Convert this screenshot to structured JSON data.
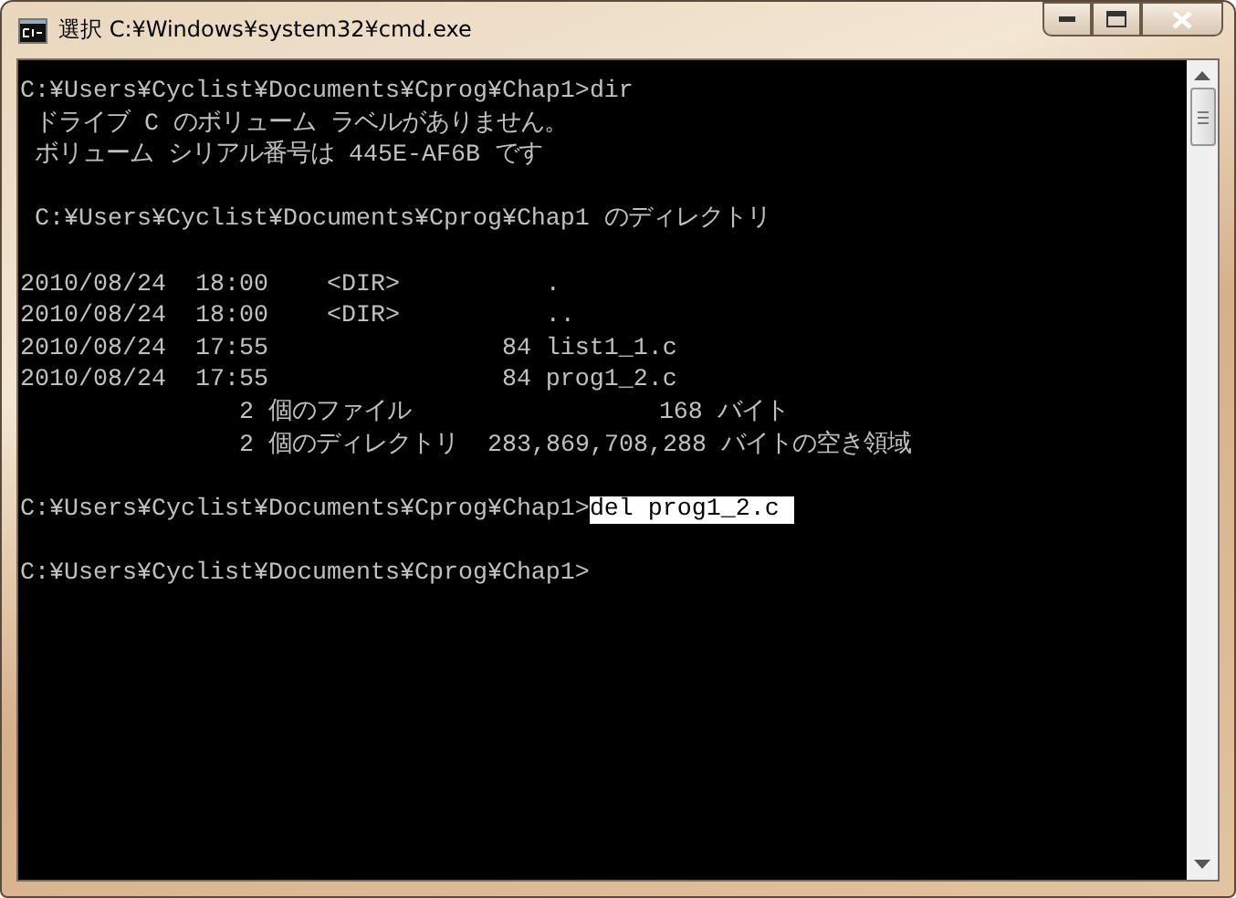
{
  "window": {
    "title": "選択 C:¥Windows¥system32¥cmd.exe"
  },
  "console": {
    "blocks": [
      {
        "lines": [
          {
            "kind": "prompt",
            "prompt": "C:¥Users¥Cyclist¥Documents¥Cprog¥Chap1>",
            "command": "dir"
          },
          {
            "kind": "output",
            "text": " ドライブ C のボリューム ラベルがありません。"
          },
          {
            "kind": "output",
            "text": " ボリューム シリアル番号は 445E-AF6B です"
          }
        ]
      },
      {
        "lines": [
          {
            "kind": "output",
            "text": " C:¥Users¥Cyclist¥Documents¥Cprog¥Chap1 のディレクトリ"
          }
        ]
      },
      {
        "lines": [
          {
            "kind": "output",
            "text": "2010/08/24  18:00    <DIR>          ."
          },
          {
            "kind": "output",
            "text": "2010/08/24  18:00    <DIR>          .."
          },
          {
            "kind": "output",
            "text": "2010/08/24  17:55                84 list1_1.c"
          },
          {
            "kind": "output",
            "text": "2010/08/24  17:55                84 prog1_2.c"
          },
          {
            "kind": "output",
            "text": "               2 個のファイル                 168 バイト"
          },
          {
            "kind": "output",
            "text": "               2 個のディレクトリ  283,869,708,288 バイトの空き領域"
          }
        ]
      },
      {
        "lines": [
          {
            "kind": "prompt",
            "prompt": "C:¥Users¥Cyclist¥Documents¥Cprog¥Chap1>",
            "command": "del prog1_2.c",
            "selected": true
          }
        ]
      },
      {
        "lines": [
          {
            "kind": "prompt",
            "prompt": "C:¥Users¥Cyclist¥Documents¥Cprog¥Chap1>"
          }
        ]
      }
    ]
  }
}
